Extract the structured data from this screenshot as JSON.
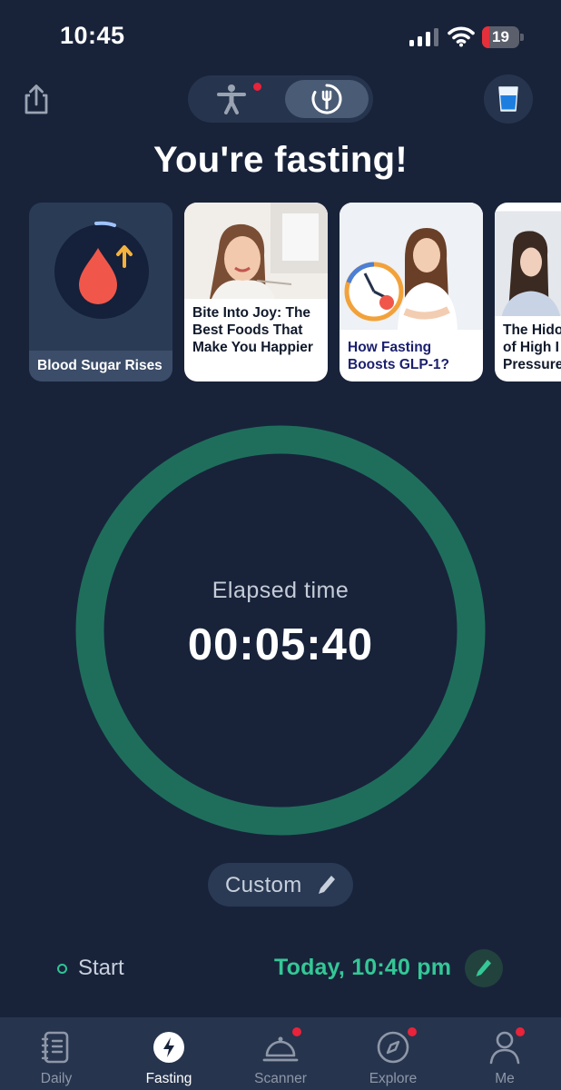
{
  "status_bar": {
    "time": "10:45",
    "battery_level": "19",
    "battery_fraction": 0.19
  },
  "header": {
    "title": "You're fasting!",
    "icons": {
      "share": "share-icon",
      "body_mode": "person-icon",
      "fasting_mode": "fork-clock-icon",
      "water": "water-glass-icon"
    }
  },
  "cards": [
    {
      "caption": "Blood Sugar Rises",
      "icon": "blood-drop-icon"
    },
    {
      "caption": "Bite Into Joy: The Best Foods That Make You Happier"
    },
    {
      "caption": "How Fasting Boosts GLP-1?"
    },
    {
      "caption": "The Hidden Dangers of High Blood Pressure",
      "visible_caption": "The Hido\nof High I\nPressure"
    }
  ],
  "timer": {
    "label": "Elapsed time",
    "value": "00:05:40",
    "ring_color": "#1f6e5c"
  },
  "plan": {
    "label": "Custom"
  },
  "start": {
    "label": "Start",
    "value": "Today, 10:40 pm",
    "accent": "#34c896"
  },
  "tabbar": {
    "items": [
      {
        "label": "Daily",
        "icon": "journal-icon",
        "badge": false
      },
      {
        "label": "Fasting",
        "icon": "bolt-icon",
        "badge": false,
        "active": true
      },
      {
        "label": "Scanner",
        "icon": "cloche-icon",
        "badge": true
      },
      {
        "label": "Explore",
        "icon": "compass-icon",
        "badge": true
      },
      {
        "label": "Me",
        "icon": "profile-icon",
        "badge": true
      }
    ]
  },
  "colors": {
    "background": "#18233a",
    "surface": "#26344d",
    "badge": "#e8233a"
  }
}
